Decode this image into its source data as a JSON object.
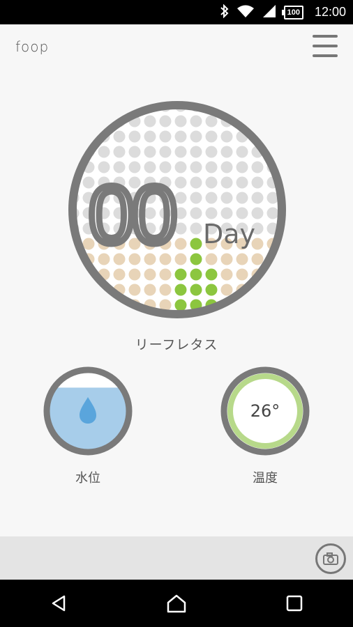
{
  "status_bar": {
    "time": "12:00",
    "battery": "100",
    "icons": [
      "bluetooth-icon",
      "wifi-icon",
      "signal-icon",
      "battery-icon"
    ]
  },
  "app": {
    "logo": "foop",
    "menu_icon": "hamburger-menu-icon"
  },
  "growth": {
    "days": "00",
    "unit": "Day",
    "crop": "リーフレタス"
  },
  "water": {
    "label": "水位",
    "icon": "water-drop-icon",
    "level": 0.8
  },
  "temperature": {
    "label": "温度",
    "value": "26°"
  },
  "actions": {
    "camera_icon": "camera-icon"
  },
  "navigation": {
    "buttons": [
      "back-icon",
      "home-icon",
      "recents-icon"
    ]
  },
  "colors": {
    "ring": "#7a7a7a",
    "dot_grey": "#dcdcdc",
    "dot_tan": "#e8d4b8",
    "dot_green": "#8cc63f",
    "water": "#a7cdea",
    "drop": "#5aa5dc",
    "temp_ring": "#b7d98a"
  }
}
